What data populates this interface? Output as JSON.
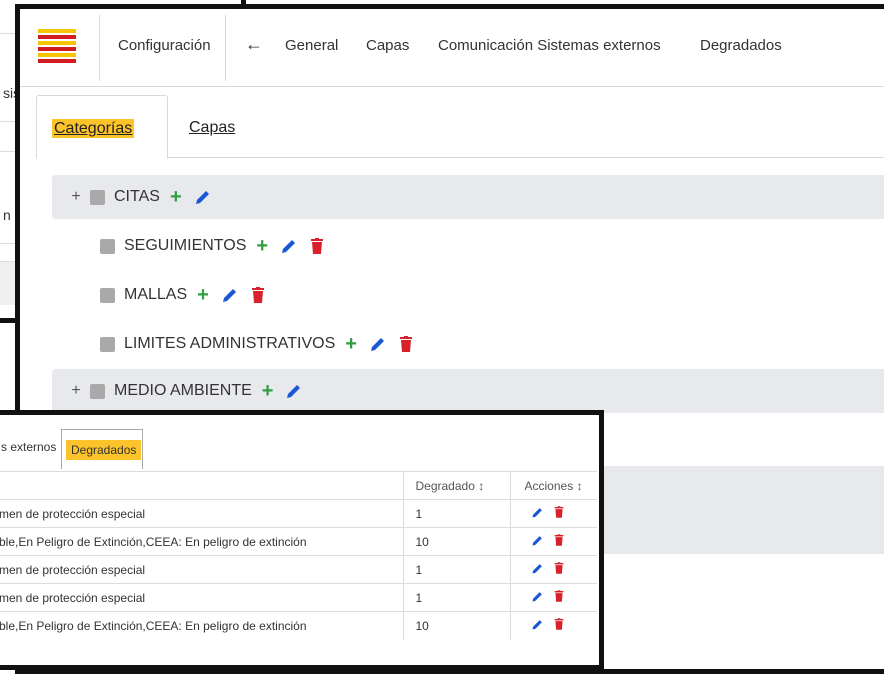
{
  "background_window": {
    "fragments": [
      "sis",
      "n el"
    ]
  },
  "header": {
    "title": "Configuración",
    "nav": [
      "General",
      "Capas",
      "Comunicación Sistemas externos",
      "Degradados"
    ]
  },
  "subtabs": {
    "active": "Categorías",
    "other": "Capas"
  },
  "categories": [
    {
      "label": "CITAS",
      "expandable": true,
      "can_delete": false
    },
    {
      "label": "SEGUIMIENTOS",
      "expandable": false,
      "can_delete": true
    },
    {
      "label": "MALLAS",
      "expandable": false,
      "can_delete": true
    },
    {
      "label": "LIMITES ADMINISTRATIVOS",
      "expandable": false,
      "can_delete": true
    },
    {
      "label": "MEDIO AMBIENTE",
      "expandable": true,
      "can_delete": false
    }
  ],
  "degradados": {
    "tab_prev": "s externos",
    "tab_active": "Degradados",
    "columns": {
      "description": "",
      "degradado": "Degradado",
      "acciones": "Acciones",
      "sort_icon": "↕"
    },
    "rows": [
      {
        "description": "men de protección especial",
        "degradado": "1"
      },
      {
        "description": "ble,En Peligro de Extinción,CEEA: En peligro de extinción",
        "degradado": "10"
      },
      {
        "description": "men de protección especial",
        "degradado": "1"
      },
      {
        "description": "men de protección especial",
        "degradado": "1"
      },
      {
        "description": "ble,En Peligro de Extinción,CEEA: En peligro de extinción",
        "degradado": "10"
      }
    ]
  },
  "colors": {
    "accent_yellow": "#fcc42a",
    "add_green": "#2e9e3f",
    "edit_blue": "#1a57d6",
    "delete_red": "#d9212c",
    "row_gray": "#e8e9ec"
  },
  "icons": {
    "back": "arrow-left-icon",
    "add": "plus-icon",
    "edit": "pencil-icon",
    "delete": "trash-icon",
    "expand": "expand-plus-icon",
    "sort": "sort-icon"
  }
}
